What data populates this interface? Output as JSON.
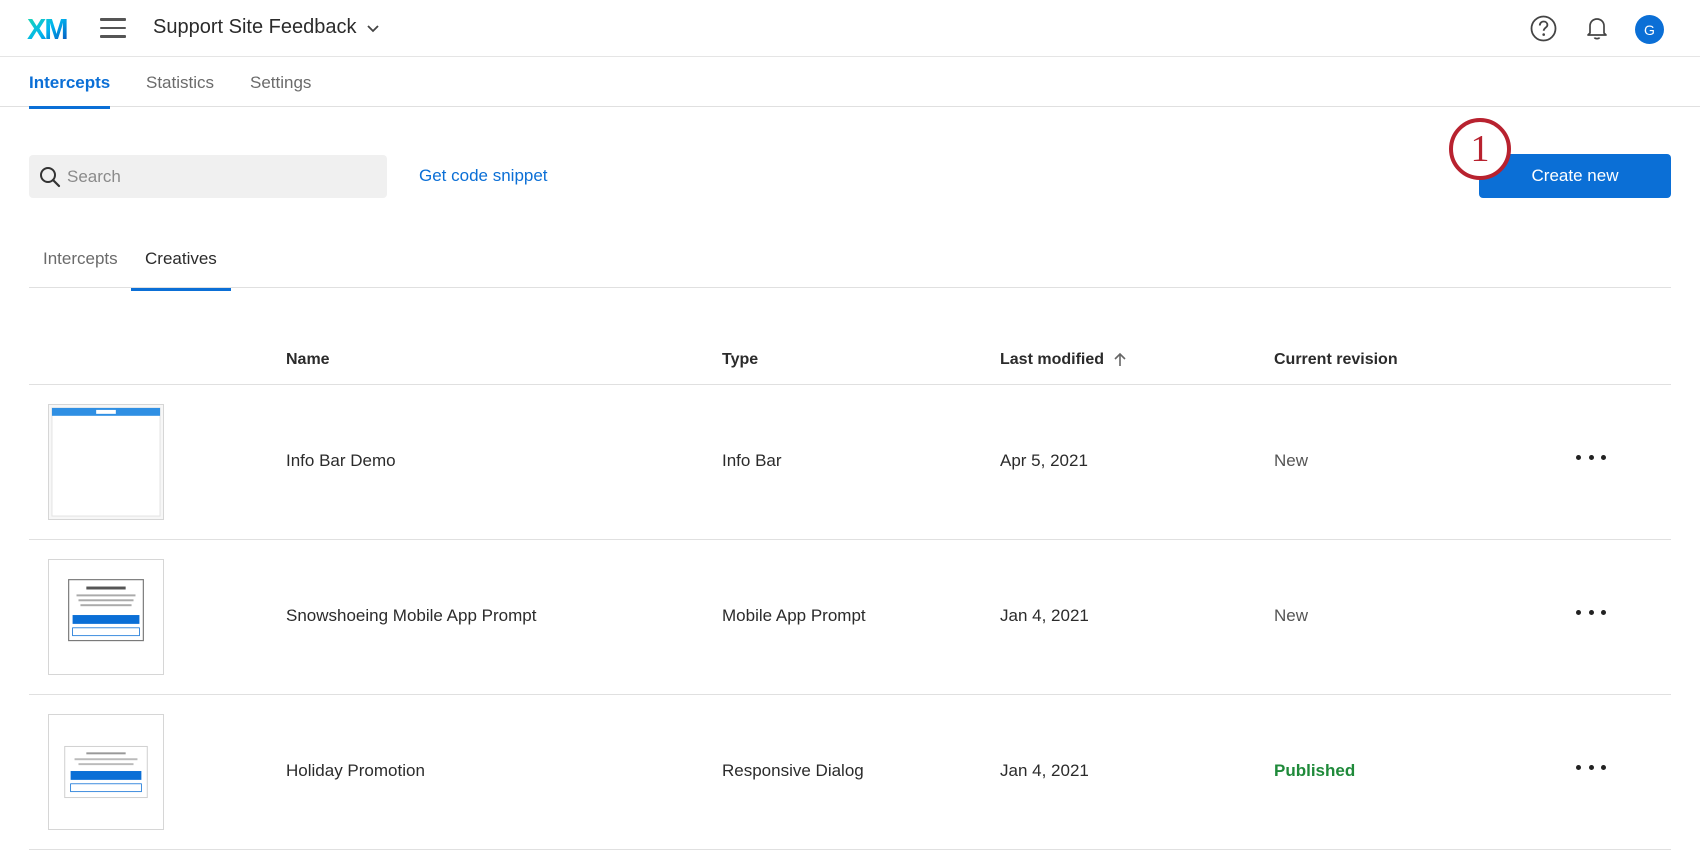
{
  "header": {
    "logo_text": "XM",
    "project_title": "Support Site Feedback",
    "avatar_initial": "G"
  },
  "primary_tabs": [
    {
      "label": "Intercepts",
      "active": true
    },
    {
      "label": "Statistics",
      "active": false
    },
    {
      "label": "Settings",
      "active": false
    }
  ],
  "toolbar": {
    "search_placeholder": "Search",
    "code_link": "Get code snippet",
    "create_label": "Create new",
    "step_number": "1"
  },
  "secondary_tabs": [
    {
      "label": "Intercepts",
      "active": false
    },
    {
      "label": "Creatives",
      "active": true
    }
  ],
  "table": {
    "columns": [
      "Name",
      "Type",
      "Last modified",
      "Current revision"
    ],
    "rows": [
      {
        "name": "Info Bar Demo",
        "type": "Info Bar",
        "modified": "Apr 5, 2021",
        "revision": "New",
        "thumb": "info-bar"
      },
      {
        "name": "Snowshoeing Mobile App Prompt",
        "type": "Mobile App Prompt",
        "modified": "Jan 4, 2021",
        "revision": "New",
        "thumb": "app-prompt"
      },
      {
        "name": "Holiday Promotion",
        "type": "Responsive Dialog",
        "modified": "Jan 4, 2021",
        "revision": "Published",
        "thumb": "dialog"
      }
    ]
  },
  "colors": {
    "accent": "#0b6fd6",
    "published": "#1f8a3a",
    "step_marker": "#b8222f"
  }
}
